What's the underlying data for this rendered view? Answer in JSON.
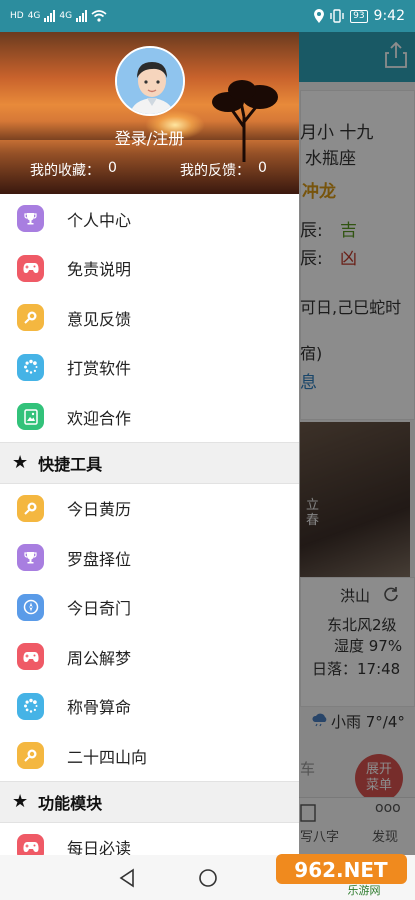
{
  "status_bar": {
    "left_labels": [
      "HD",
      "4G",
      "4G"
    ],
    "battery": "93",
    "time": "9:42",
    "icons": [
      "signal-icon",
      "wifi-icon",
      "location-icon",
      "vibrate-icon",
      "battery-icon"
    ]
  },
  "background_app": {
    "lunar_line1": "月小 十九",
    "lunar_line2": "水瓶座",
    "conflict": "冲龙",
    "hour1_label": "辰:",
    "hour1_value": "吉",
    "hour2_label": "辰:",
    "hour2_value": "凶",
    "date_line": "可日,己巳蛇时",
    "paren_line": "宿)",
    "link_text": "息",
    "photo_caption": "立春",
    "weather_city": "洪山",
    "weather_wind": "东北风2级",
    "weather_humidity": "湿度 97%",
    "weather_sunset": "日落：17:48",
    "weather_forecast": "小雨 7°/4°",
    "partial_text": "车",
    "fab_line1": "展开",
    "fab_line2": "菜单",
    "nav_bazi": "写八字",
    "nav_discover": "发现",
    "nav_discover_icon": "ooo"
  },
  "drawer": {
    "login_label": "登录/注册",
    "favorites_label": "我的收藏：",
    "favorites_count": "0",
    "feedback_label": "我的反馈：",
    "feedback_count": "0",
    "items_top": [
      {
        "label": "个人中心",
        "icon": "trophy-icon",
        "color": "#a87ee0"
      },
      {
        "label": "免责说明",
        "icon": "gamepad-icon",
        "color": "#ef5a66"
      },
      {
        "label": "意见反馈",
        "icon": "magnifier-icon",
        "color": "#f4b740"
      },
      {
        "label": "打赏软件",
        "icon": "dots-ring-icon",
        "color": "#45b3e6"
      },
      {
        "label": "欢迎合作",
        "icon": "image-icon",
        "color": "#32c27a"
      }
    ],
    "section_tools": "快捷工具",
    "items_tools": [
      {
        "label": "今日黄历",
        "icon": "magnifier-icon",
        "color": "#f4b740"
      },
      {
        "label": "罗盘择位",
        "icon": "trophy-icon",
        "color": "#a87ee0"
      },
      {
        "label": "今日奇门",
        "icon": "compass-icon",
        "color": "#5a9be8"
      },
      {
        "label": "周公解梦",
        "icon": "gamepad-icon",
        "color": "#ef5a66"
      },
      {
        "label": "称骨算命",
        "icon": "dots-ring-icon",
        "color": "#45b3e6"
      },
      {
        "label": "二十四山向",
        "icon": "magnifier-icon",
        "color": "#f4b740"
      }
    ],
    "section_modules": "功能模块",
    "items_modules": [
      {
        "label": "每日必读",
        "icon": "gamepad-icon",
        "color": "#ef5a66"
      }
    ]
  },
  "watermark": {
    "brand": "962.NET",
    "subtitle": "乐游网"
  }
}
